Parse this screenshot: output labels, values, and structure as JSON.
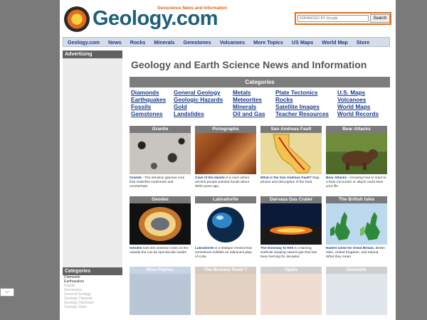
{
  "header": {
    "logo_text": "Geology.com",
    "tagline": "Geoscience News and Information",
    "search_placeholder": "ENHANCED BY Google",
    "search_button": "Search"
  },
  "nav": [
    "Geology.com",
    "News",
    "Rocks",
    "Minerals",
    "Gemstones",
    "Volcanoes",
    "More Topics",
    "US Maps",
    "World Map",
    "Store"
  ],
  "sidebar": {
    "advertising": "Advertising",
    "categories_title": "Categories",
    "categories": [
      "Diamonds",
      "Earthquakes",
      "Fossils",
      "Gemstones",
      "General Geology",
      "Geologic Hazards",
      "Geology Dictionary",
      "Geology Store"
    ]
  },
  "main": {
    "title": "Geology and Earth Science News and Information",
    "categories_bar": "Categories",
    "category_links": [
      "Diamonds",
      "General Geology",
      "Metals",
      "Plate Tectonics",
      "U.S. Maps",
      "Earthquakes",
      "Geologic Hazards",
      "Meteorites",
      "Rocks",
      "Volcanoes",
      "Fossils",
      "Gold",
      "Minerals",
      "Satellite Images",
      "World Maps",
      "Gemstones",
      "Landslides",
      "Oil and Gas",
      "Teacher Resources",
      "World Records"
    ],
    "thumbs": [
      {
        "title": "Granite",
        "link": "Granite",
        "text": " - The intrusive igneous rock that underlies continents and countertops."
      },
      {
        "title": "Pictographs",
        "link": "Cave of the Hands",
        "text": " is a cave where ancient people painted hands about 9000 years ago."
      },
      {
        "title": "San Andreas Fault",
        "link": "What is the San Andreas Fault?",
        "text": " Map, photos and description of the fault."
      },
      {
        "title": "Bear Attacks",
        "link": "Bear Attacks",
        "text": " - Knowing how to react to a bear encounter or attack could save your life."
      },
      {
        "title": "Geodes",
        "link": "Geodes",
        "text": " look like ordinary rocks on the outside but can be spectacular inside!"
      },
      {
        "title": "Labradorite",
        "link": "Labradorite",
        "text": " is a feldspar mineral that sometimes exhibits an iridescent play-of-color."
      },
      {
        "title": "Darvaza Gas Crater",
        "link": "The Doorway to Hell",
        "text": " is a flaming sinkhole seeping natural gas that has been burning for decades."
      },
      {
        "title": "The British Isles",
        "link": "Names Used for Great Britain,",
        "text": " British Isles, United Kingdom, and Ireland. What they mean."
      },
      {
        "title": "Blue Flames",
        "link": "",
        "text": ""
      },
      {
        "title": "The Bravery Rock ?",
        "link": "",
        "text": ""
      },
      {
        "title": "Opals",
        "link": "",
        "text": ""
      },
      {
        "title": "Dolomite",
        "link": "",
        "text": ""
      }
    ]
  }
}
